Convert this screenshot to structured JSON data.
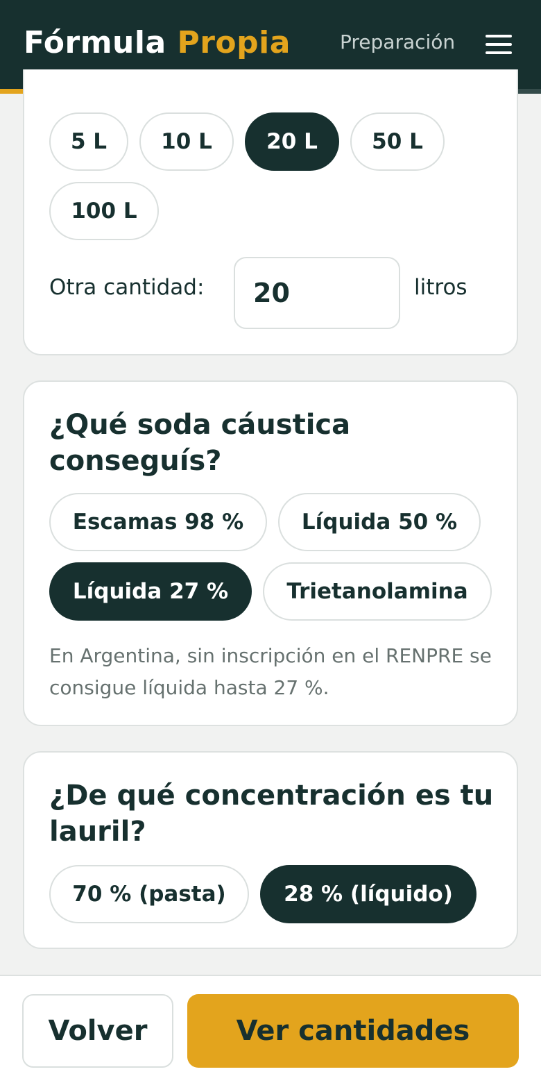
{
  "header": {
    "brand_main": "Fórmula",
    "brand_accent": "Propia",
    "step_label": "Preparación",
    "menu_icon": "menu-icon",
    "progress_fraction": 0.15
  },
  "liters": {
    "options": [
      "5 L",
      "10 L",
      "20 L",
      "50 L",
      "100 L"
    ],
    "selected": "20 L",
    "other_label": "Otra cantidad:",
    "other_value": "20",
    "unit": "litros"
  },
  "soda": {
    "title": "¿Qué soda cáustica conseguís?",
    "options": [
      "Escamas 98 %",
      "Líquida 50 %",
      "Líquida 27 %",
      "Trietanolamina"
    ],
    "selected": "Líquida 27 %",
    "note": "En Argentina, sin inscripción en el RENPRE se consigue líquida hasta 27 %."
  },
  "lauril": {
    "title": "¿De qué concentración es tu lauril?",
    "options": [
      "70 % (pasta)",
      "28 % (líquido)"
    ],
    "selected": "28 % (líquido)"
  },
  "footer": {
    "back_label": "Volver",
    "next_label": "Ver cantidades"
  },
  "colors": {
    "primary": "#17302f",
    "accent": "#e3a41d",
    "background": "#f1f2f1"
  }
}
